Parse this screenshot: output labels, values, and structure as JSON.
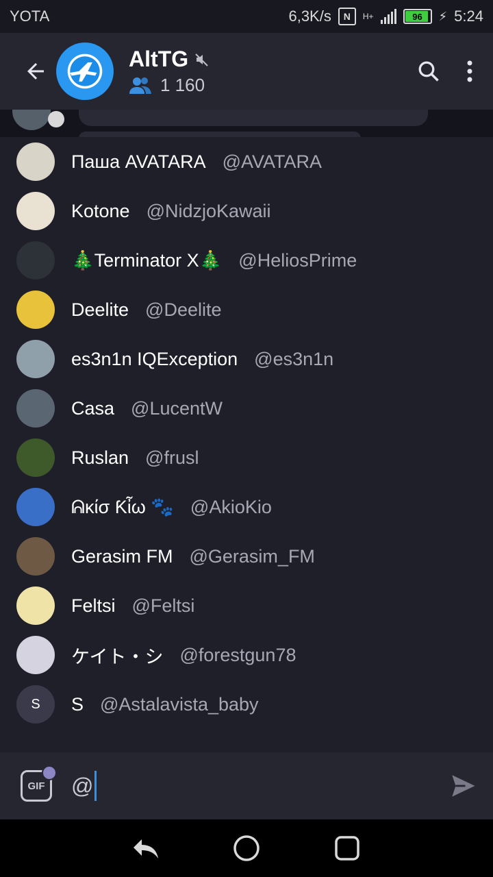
{
  "status_bar": {
    "carrier": "YOTA",
    "speed": "6,3K/s",
    "nfc": "N",
    "network": "H+",
    "battery": "96",
    "time": "5:24"
  },
  "header": {
    "title": "AltTG",
    "members": "1 160",
    "icons": [
      "back-arrow-icon",
      "muted-speaker-icon",
      "members-icon",
      "search-icon",
      "more-vert-icon"
    ]
  },
  "mentions": [
    {
      "name": "Паша AVATARA",
      "username": "@AVATARA",
      "avatar_color": "#d8d4c8"
    },
    {
      "name": "Kotone",
      "username": "@NidzjoKawaii",
      "avatar_color": "#e9e1d2"
    },
    {
      "name": "🎄Terminator X🎄",
      "username": "@HeliosPrime",
      "avatar_color": "#2c3238"
    },
    {
      "name": "Deelite",
      "username": "@Deelite",
      "avatar_color": "#e8c23a"
    },
    {
      "name": "es3n1n IQException",
      "username": "@es3n1n",
      "avatar_color": "#8fa0ab"
    },
    {
      "name": "Casa",
      "username": "@LucentW",
      "avatar_color": "#5b6673"
    },
    {
      "name": "Ruslan",
      "username": "@frusl",
      "avatar_color": "#3f5a2a"
    },
    {
      "name": "ᕱĸίσ Ƙἶω 🐾",
      "username": "@AkioKio",
      "avatar_color": "#3a6fc8"
    },
    {
      "name": "Gerasim FM",
      "username": "@Gerasim_FM",
      "avatar_color": "#6e5a44"
    },
    {
      "name": "Feltsi",
      "username": "@Feltsi",
      "avatar_color": "#f0e3a8"
    },
    {
      "name": "ケイト・シ",
      "username": "@forestgun78",
      "avatar_color": "#d6d3e0"
    },
    {
      "name": "S",
      "username": "@Astalavista_baby",
      "avatar_color": "#3a3a4a",
      "initial": "S"
    }
  ],
  "input": {
    "value": "@",
    "gif_label": "GIF"
  },
  "colors": {
    "accent": "#3d8fe0",
    "header_bg": "#262631",
    "list_bg": "#1f1f2a",
    "secondary_text": "#a8a8b4"
  }
}
